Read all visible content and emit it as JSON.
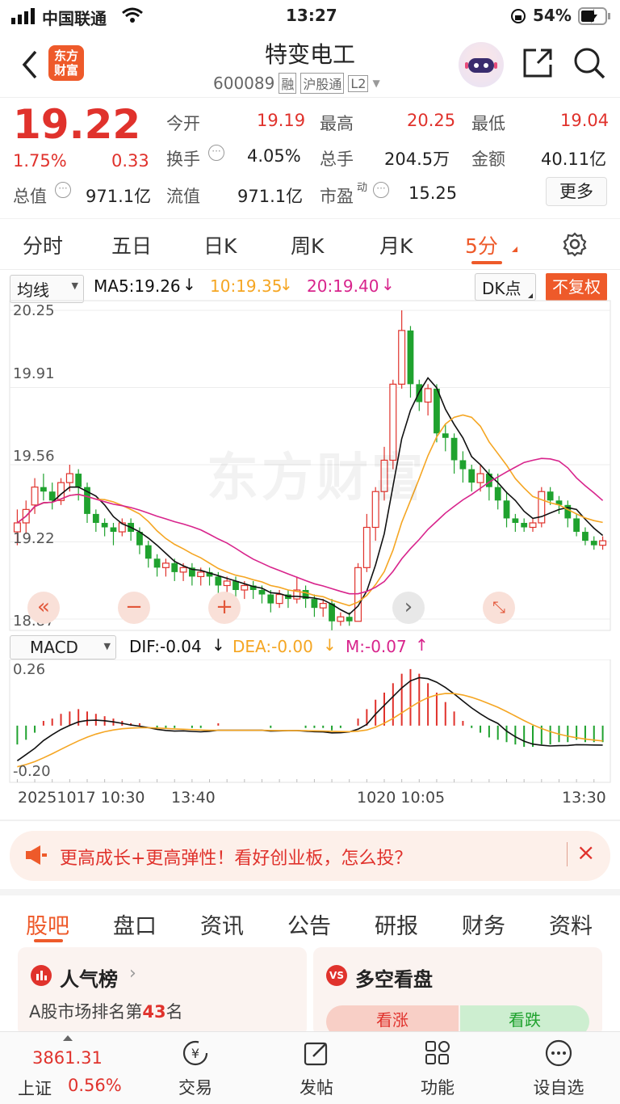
{
  "status": {
    "carrier": "中国联通",
    "time": "13:27",
    "battery": "54%"
  },
  "header": {
    "logo_line1": "东方",
    "logo_line2": "财富",
    "title": "特变电工",
    "code": "600089",
    "tag1": "融",
    "tag2": "沪股通",
    "tag3": "L2"
  },
  "quote": {
    "price": "19.22",
    "pct": "1.75%",
    "change": "0.33",
    "rows": [
      [
        {
          "label": "今开",
          "value": "19.19",
          "red": true
        },
        {
          "label": "最高",
          "value": "20.25",
          "red": true
        },
        {
          "label": "最低",
          "value": "19.04",
          "red": true
        }
      ],
      [
        {
          "label": "换手",
          "value": "4.05%",
          "info": true
        },
        {
          "label": "总手",
          "value": "204.5万"
        },
        {
          "label": "金额",
          "value": "40.11亿"
        }
      ]
    ],
    "total_cap_label": "总值",
    "total_cap": "971.1亿",
    "float_label": "流值",
    "float_cap": "971.1亿",
    "pe_label": "市盈",
    "pe_sup": "动",
    "pe": "15.25",
    "more": "更多"
  },
  "tabs": [
    "分时",
    "五日",
    "日K",
    "周K",
    "月K",
    "5分"
  ],
  "active_tab": "5分",
  "chart": {
    "ma_select": "均线",
    "ma5": "MA5:19.26",
    "ma10": "10:19.35",
    "ma20": "20:19.40",
    "dk": "DK点",
    "fq": "不复权",
    "y_ticks": [
      "20.25",
      "19.91",
      "19.56",
      "19.22",
      "18.87"
    ],
    "watermark": "东方财富",
    "macd_select": "MACD",
    "dif": "DIF:-0.04",
    "dea": "DEA:-0.00",
    "m": "M:-0.07",
    "macd_ticks": [
      "0.26",
      "-0.20"
    ],
    "x_labels": [
      "20251017 10:30",
      "13:40",
      "1020 10:05",
      "13:30"
    ],
    "colors": {
      "up": "#e0322c",
      "down": "#1fa22e",
      "ma5": "#111111",
      "ma10": "#f5a623",
      "ma20": "#d8248c"
    }
  },
  "chart_data": {
    "type": "candlestick",
    "ylim": [
      18.87,
      20.25
    ],
    "candles": [
      [
        19.26,
        19.3,
        19.2,
        19.36
      ],
      [
        19.3,
        19.36,
        19.25,
        19.4
      ],
      [
        19.38,
        19.46,
        19.34,
        19.5
      ],
      [
        19.46,
        19.44,
        19.4,
        19.52
      ],
      [
        19.44,
        19.4,
        19.36,
        19.48
      ],
      [
        19.4,
        19.48,
        19.38,
        19.5
      ],
      [
        19.48,
        19.52,
        19.44,
        19.56
      ],
      [
        19.52,
        19.46,
        19.4,
        19.54
      ],
      [
        19.46,
        19.34,
        19.3,
        19.48
      ],
      [
        19.34,
        19.3,
        19.26,
        19.36
      ],
      [
        19.3,
        19.28,
        19.24,
        19.32
      ],
      [
        19.28,
        19.26,
        19.2,
        19.3
      ],
      [
        19.26,
        19.3,
        19.24,
        19.32
      ],
      [
        19.3,
        19.26,
        19.22,
        19.32
      ],
      [
        19.26,
        19.2,
        19.16,
        19.28
      ],
      [
        19.2,
        19.14,
        19.1,
        19.22
      ],
      [
        19.14,
        19.1,
        19.06,
        19.16
      ],
      [
        19.1,
        19.12,
        19.06,
        19.14
      ],
      [
        19.12,
        19.08,
        19.04,
        19.14
      ],
      [
        19.08,
        19.1,
        19.04,
        19.12
      ],
      [
        19.1,
        19.06,
        19.02,
        19.12
      ],
      [
        19.06,
        19.08,
        19.02,
        19.1
      ],
      [
        19.08,
        19.06,
        19.02,
        19.1
      ],
      [
        19.06,
        19.02,
        18.98,
        19.08
      ],
      [
        19.02,
        19.04,
        18.98,
        19.06
      ],
      [
        19.04,
        19.0,
        18.96,
        19.06
      ],
      [
        19.0,
        19.02,
        18.96,
        19.04
      ],
      [
        19.02,
        19.0,
        18.96,
        19.04
      ],
      [
        19.0,
        18.98,
        18.94,
        19.02
      ],
      [
        18.98,
        18.94,
        18.9,
        19.0
      ],
      [
        18.94,
        18.98,
        18.92,
        19.0
      ],
      [
        18.98,
        18.96,
        18.92,
        19.0
      ],
      [
        18.96,
        19.0,
        18.94,
        19.06
      ],
      [
        19.0,
        18.96,
        18.92,
        19.02
      ],
      [
        18.96,
        18.92,
        18.88,
        18.98
      ],
      [
        18.92,
        18.94,
        18.88,
        18.96
      ],
      [
        18.94,
        18.86,
        18.82,
        18.96
      ],
      [
        18.86,
        18.88,
        18.84,
        18.9
      ],
      [
        18.88,
        18.86,
        18.84,
        18.9
      ],
      [
        18.86,
        19.1,
        18.86,
        19.12
      ],
      [
        19.1,
        19.28,
        19.08,
        19.34
      ],
      [
        19.28,
        19.44,
        19.22,
        19.46
      ],
      [
        19.44,
        19.58,
        19.4,
        19.64
      ],
      [
        19.58,
        19.92,
        19.54,
        19.94
      ],
      [
        19.92,
        20.16,
        19.9,
        20.25
      ],
      [
        20.16,
        19.92,
        19.86,
        20.18
      ],
      [
        19.92,
        19.84,
        19.8,
        19.94
      ],
      [
        19.84,
        19.9,
        19.78,
        19.92
      ],
      [
        19.9,
        19.7,
        19.66,
        19.92
      ],
      [
        19.7,
        19.68,
        19.62,
        19.74
      ],
      [
        19.68,
        19.58,
        19.52,
        19.7
      ],
      [
        19.58,
        19.54,
        19.48,
        19.62
      ],
      [
        19.54,
        19.48,
        19.44,
        19.56
      ],
      [
        19.48,
        19.52,
        19.44,
        19.56
      ],
      [
        19.52,
        19.46,
        19.4,
        19.54
      ],
      [
        19.46,
        19.4,
        19.36,
        19.52
      ],
      [
        19.4,
        19.32,
        19.28,
        19.44
      ],
      [
        19.32,
        19.3,
        19.26,
        19.34
      ],
      [
        19.3,
        19.28,
        19.26,
        19.32
      ],
      [
        19.28,
        19.3,
        19.26,
        19.32
      ],
      [
        19.3,
        19.44,
        19.28,
        19.46
      ],
      [
        19.44,
        19.4,
        19.38,
        19.46
      ],
      [
        19.4,
        19.38,
        19.34,
        19.42
      ],
      [
        19.38,
        19.32,
        19.28,
        19.4
      ],
      [
        19.32,
        19.26,
        19.24,
        19.34
      ],
      [
        19.26,
        19.22,
        19.2,
        19.28
      ],
      [
        19.22,
        19.2,
        19.18,
        19.24
      ],
      [
        19.2,
        19.22,
        19.18,
        19.24
      ]
    ],
    "macd_bars": [
      -0.08,
      -0.06,
      -0.03,
      0.02,
      0.03,
      0.05,
      0.06,
      0.07,
      0.06,
      0.05,
      0.04,
      0.03,
      0.02,
      0.01,
      0.01,
      0.0,
      -0.01,
      -0.01,
      -0.01,
      0.0,
      -0.01,
      -0.01,
      0.0,
      0.01,
      0.0,
      0.0,
      0.0,
      0.0,
      0.0,
      -0.01,
      0.0,
      0.0,
      0.0,
      -0.01,
      -0.01,
      -0.01,
      -0.02,
      -0.01,
      0.0,
      0.03,
      0.07,
      0.11,
      0.14,
      0.18,
      0.22,
      0.24,
      0.22,
      0.18,
      0.14,
      0.1,
      0.06,
      0.02,
      -0.01,
      -0.03,
      -0.05,
      -0.06,
      -0.07,
      -0.08,
      -0.09,
      -0.09,
      -0.08,
      -0.08,
      -0.07,
      -0.07,
      -0.06,
      -0.07,
      -0.07,
      -0.07
    ]
  },
  "banner": {
    "text": "更高成长+更高弹性！看好创业板，怎么投？"
  },
  "subtabs": [
    "股吧",
    "盘口",
    "资讯",
    "公告",
    "研报",
    "财务",
    "资料"
  ],
  "cards": {
    "left_title": "人气榜",
    "left_sub_pre": "A股市场排名第",
    "left_rank": "43",
    "left_sub_post": "名",
    "right_title": "多空看盘",
    "bull": "看涨",
    "bear": "看跌"
  },
  "bottom": {
    "index_value": "3861.31",
    "index_name": "上证",
    "index_pct": "0.56%",
    "trade": "交易",
    "post": "发帖",
    "func": "功能",
    "watch": "设自选"
  }
}
